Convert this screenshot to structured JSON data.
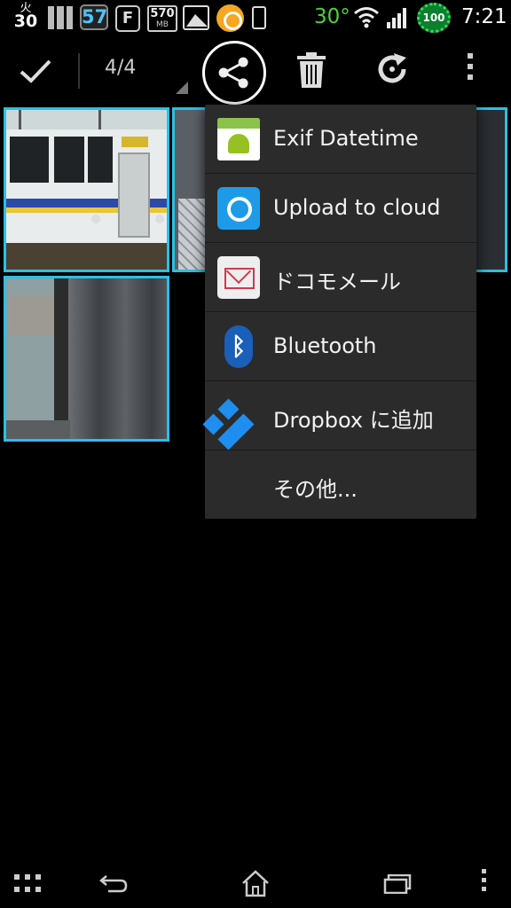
{
  "status_bar": {
    "day_of_week": "火",
    "day": "30",
    "badge_number": "57",
    "f_badge": "F",
    "memory_value": "570",
    "memory_unit": "MB",
    "temperature": "30°",
    "battery": "100",
    "time": "7:21",
    "icons": [
      "calendar-icon",
      "storage-bars-icon",
      "notification-count-icon",
      "f-app-icon",
      "memory-icon",
      "gallery-icon",
      "orange-app-icon",
      "phone-icon",
      "wifi-icon",
      "signal-icon",
      "battery-icon"
    ],
    "colors": {
      "temperature": "#4cd137",
      "badge_text": "#4fc3f7",
      "battery_fill": "#0a7f2e"
    }
  },
  "action_bar": {
    "counter": "4/4",
    "icons": [
      "check-icon",
      "share-icon",
      "trash-icon",
      "rotate-icon",
      "overflow-icon"
    ]
  },
  "gallery": {
    "selection_color": "#29c0e6",
    "thumbnails": [
      {
        "name": "train",
        "selected": true
      },
      {
        "name": "second",
        "selected": true
      },
      {
        "name": "window",
        "selected": true
      }
    ]
  },
  "share_menu": {
    "items": [
      {
        "label": "Exif Datetime",
        "icon": "android-app-icon"
      },
      {
        "label": "Upload to cloud",
        "icon": "cloud-upload-icon"
      },
      {
        "label": "ドコモメール",
        "icon": "mail-icon"
      },
      {
        "label": "Bluetooth",
        "icon": "bluetooth-icon"
      },
      {
        "label": "Dropbox に追加",
        "icon": "dropbox-icon"
      },
      {
        "label": "その他...",
        "icon": ""
      }
    ]
  },
  "nav_bar": {
    "icons": [
      "apps-icon",
      "back-icon",
      "home-icon",
      "recent-apps-icon",
      "menu-icon"
    ]
  }
}
